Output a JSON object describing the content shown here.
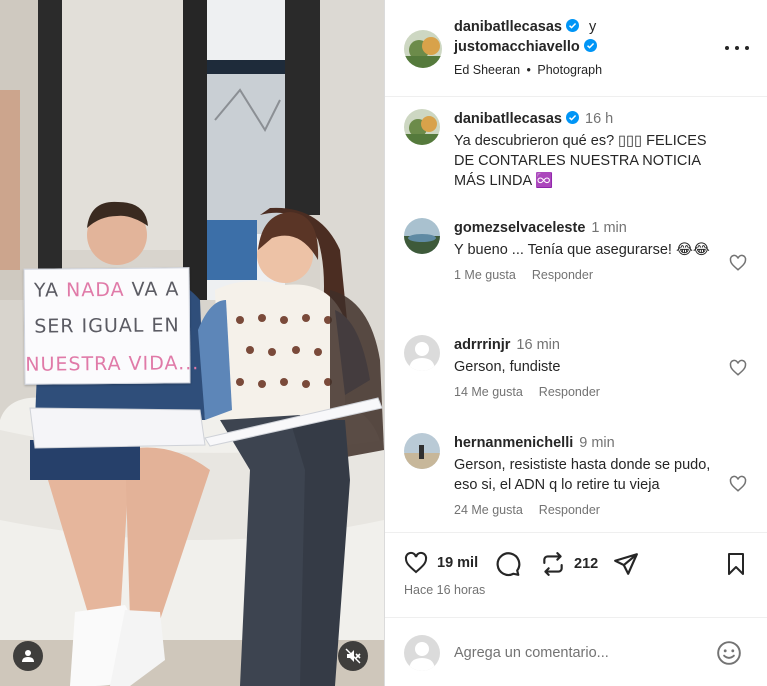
{
  "post": {
    "sign_lines": [
      {
        "a": "YA ",
        "b": "NADA",
        "c": " VA A"
      },
      {
        "a": "SER IGUAL EN",
        "b": "",
        "c": ""
      },
      {
        "a": "",
        "b": "NUESTRA VIDA",
        "c": "..."
      }
    ],
    "author": "danibatllecasas",
    "connector": "y",
    "coauthor": "justomacchiavello",
    "music": "Ed Sheeran",
    "separator": "•",
    "category": "Photograph",
    "caption": {
      "user": "danibatllecasas",
      "time": "16 h",
      "text": "Ya descubrieron qué es? ▯▯▯ FELICES DE CONTARLES NUESTRA NOTICIA MÁS LINDA ♾️"
    },
    "comments": [
      {
        "user": "gomezselvaceleste",
        "time": "1 min",
        "text": "Y bueno ... Tenía que asegurarse! 😂😂",
        "likes": "1 Me gusta",
        "reply": "Responder"
      },
      {
        "user": "adrrrinjr",
        "time": "16 min",
        "text": "Gerson, fundiste",
        "likes": "14 Me gusta",
        "reply": "Responder"
      },
      {
        "user": "hernanmenichelli",
        "time": "9 min",
        "text": "Gerson, resististe hasta donde se pudo, eso si, el ADN q lo retire tu vieja",
        "likes": "24 Me gusta",
        "reply": "Responder"
      }
    ],
    "like_count": "19 mil",
    "share_count": "212",
    "timestamp": "Hace 16 horas",
    "comment_placeholder": "Agrega un comentario..."
  },
  "colors": {
    "verified": "#0095f6",
    "muted": "#737373",
    "text": "#262626"
  },
  "icons": [
    "user-icon",
    "mute-icon",
    "more-icon",
    "verified-icon",
    "heart-icon",
    "comment-icon",
    "repost-icon",
    "share-icon",
    "bookmark-icon",
    "emoji-icon"
  ]
}
